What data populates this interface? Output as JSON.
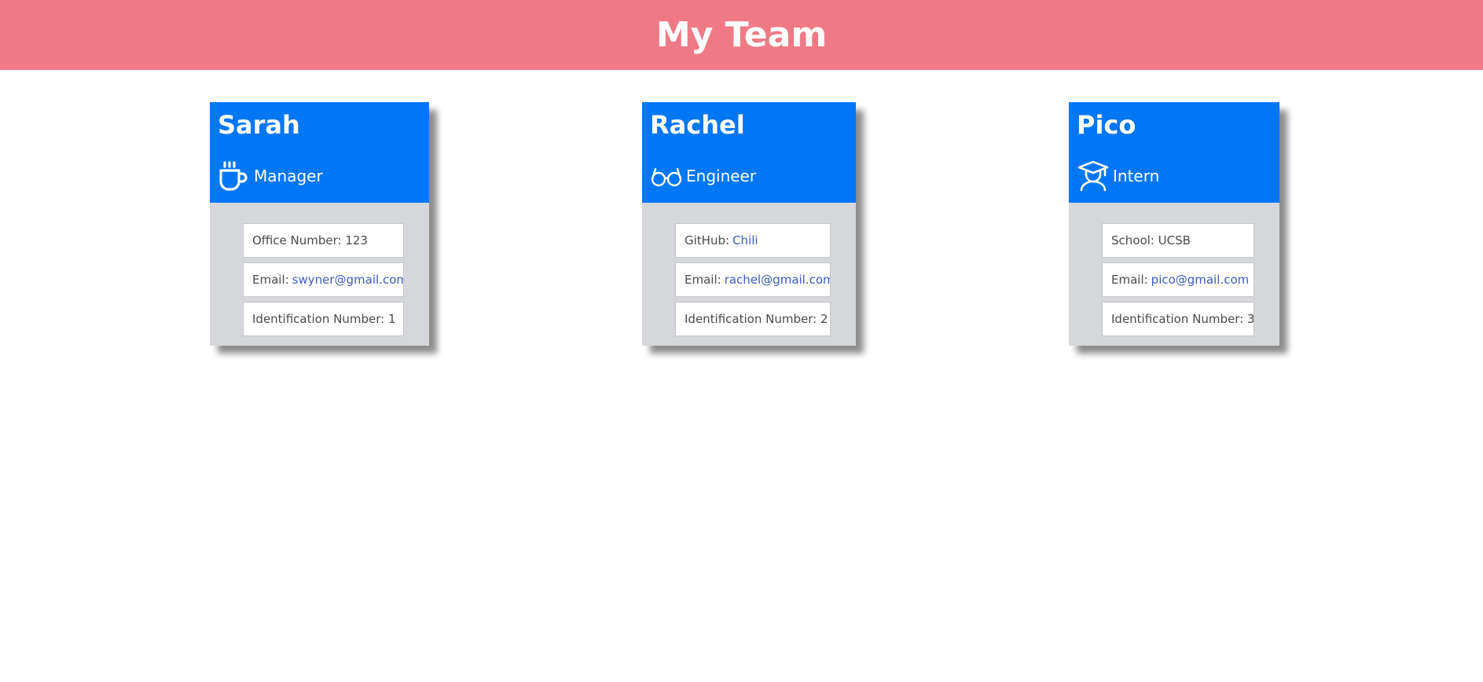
{
  "page": {
    "title": "My Team",
    "header_color": "#ef7a85",
    "card_header_color": "#0077f6",
    "card_body_color": "#d6d7da",
    "link_color": "#3d5bc5"
  },
  "members": [
    {
      "name": "Sarah",
      "role": "Manager",
      "icon": "coffee-cup-icon",
      "detail_label": "Office Number:",
      "detail_value": "123",
      "email_label": "Email:",
      "email": "swyner@gmail.com",
      "id_label": "Identification Number:",
      "id": "1"
    },
    {
      "name": "Rachel",
      "role": "Engineer",
      "icon": "glasses-icon",
      "detail_label": "GitHub:",
      "detail_value": "Chili",
      "email_label": "Email:",
      "email": "rachel@gmail.com",
      "id_label": "Identification Number:",
      "id": "2"
    },
    {
      "name": "Pico",
      "role": "Intern",
      "icon": "graduate-icon",
      "detail_label": "School:",
      "detail_value": "UCSB",
      "email_label": "Email:",
      "email": "pico@gmail.com",
      "id_label": "Identification Number:",
      "id": "3"
    }
  ]
}
